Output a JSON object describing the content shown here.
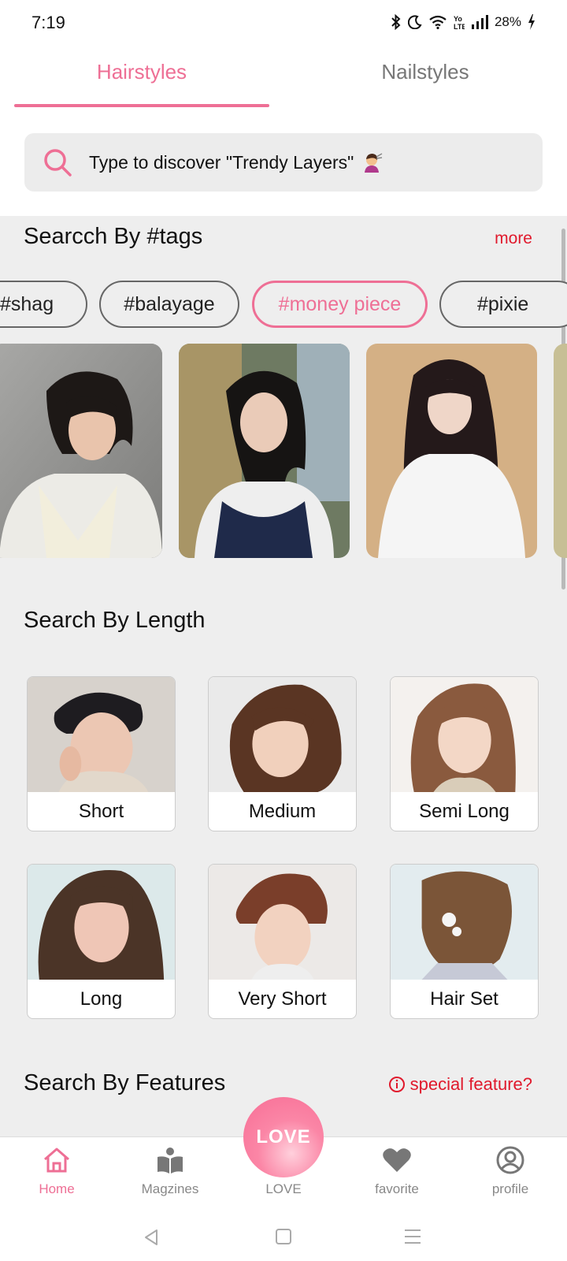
{
  "status_bar": {
    "time": "7:19",
    "battery": "28%",
    "icons": [
      "bluetooth-icon",
      "moon-icon",
      "wifi-icon",
      "volte-icon",
      "signal-icon",
      "battery-icon"
    ]
  },
  "tabs": [
    {
      "label": "Hairstyles",
      "active": true
    },
    {
      "label": "Nailstyles",
      "active": false
    }
  ],
  "search": {
    "text": "Type to discover \"Trendy Layers\"",
    "icon": "search-icon",
    "emoji": "haircut-woman-emoji"
  },
  "tags_section": {
    "title": "Searcch By #tags",
    "more": "more",
    "tags": [
      {
        "label": "#shag",
        "active": false
      },
      {
        "label": "#balayage",
        "active": false
      },
      {
        "label": "#money piece",
        "active": true
      },
      {
        "label": "#pixie",
        "active": false
      }
    ],
    "photos": [
      {
        "alt": "woman with short bob and bangs in white turtleneck"
      },
      {
        "alt": "woman with layered cut in navy top"
      },
      {
        "alt": "woman with long layers in white shirt"
      }
    ]
  },
  "length_section": {
    "title": "Search By Length",
    "items": [
      {
        "label": "Short"
      },
      {
        "label": "Medium"
      },
      {
        "label": "Semi Long"
      },
      {
        "label": "Long"
      },
      {
        "label": "Very Short"
      },
      {
        "label": "Hair Set"
      }
    ]
  },
  "features_section": {
    "title": "Search By Features",
    "special": "special feature?"
  },
  "bottom_nav": {
    "items": [
      {
        "label": "Home",
        "icon": "home-icon",
        "active": true
      },
      {
        "label": "Magzines",
        "icon": "book-icon",
        "active": false
      },
      {
        "label": "LOVE",
        "icon": "love-button",
        "active": false
      },
      {
        "label": "favorite",
        "icon": "heart-icon",
        "active": false
      },
      {
        "label": "profile",
        "icon": "profile-icon",
        "active": false
      }
    ],
    "love_button": "LOVE"
  },
  "colors": {
    "accent": "#ee6f95",
    "red": "#e0192c",
    "background": "#eeeeee"
  }
}
